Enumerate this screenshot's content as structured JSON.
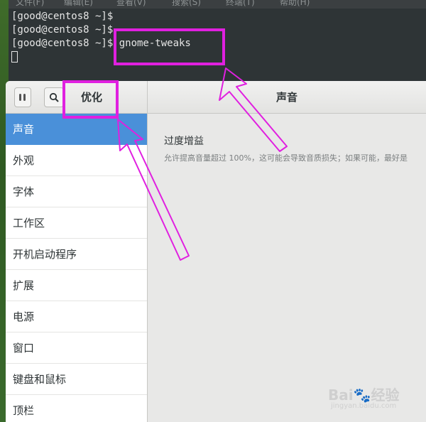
{
  "terminal": {
    "menu": [
      "文件(F)",
      "编辑(E)",
      "查看(V)",
      "搜索(S)",
      "终端(T)",
      "帮助(H)"
    ],
    "lines": [
      "[good@centos8 ~]$",
      "[good@centos8 ~]$",
      "[good@centos8 ~]$ gnome-tweaks"
    ]
  },
  "tweaks": {
    "left_title": "优化",
    "right_title": "声音",
    "sidebar": [
      {
        "label": "声音",
        "active": true
      },
      {
        "label": "外观"
      },
      {
        "label": "字体"
      },
      {
        "label": "工作区"
      },
      {
        "label": "开机启动程序"
      },
      {
        "label": "扩展"
      },
      {
        "label": "电源"
      },
      {
        "label": "窗口"
      },
      {
        "label": "键盘和鼠标"
      },
      {
        "label": "顶栏"
      }
    ],
    "setting": {
      "title": "过度增益",
      "description": "允许提高音量超过 100%，这可能会导致音质损失；如果可能，最好是"
    }
  },
  "watermark": {
    "brand": "Bai",
    "brand_suffix": "经验",
    "sub": "jingyan.baidu.com"
  },
  "colors": {
    "highlight": "#e020e0",
    "selection": "#4a90d9"
  }
}
